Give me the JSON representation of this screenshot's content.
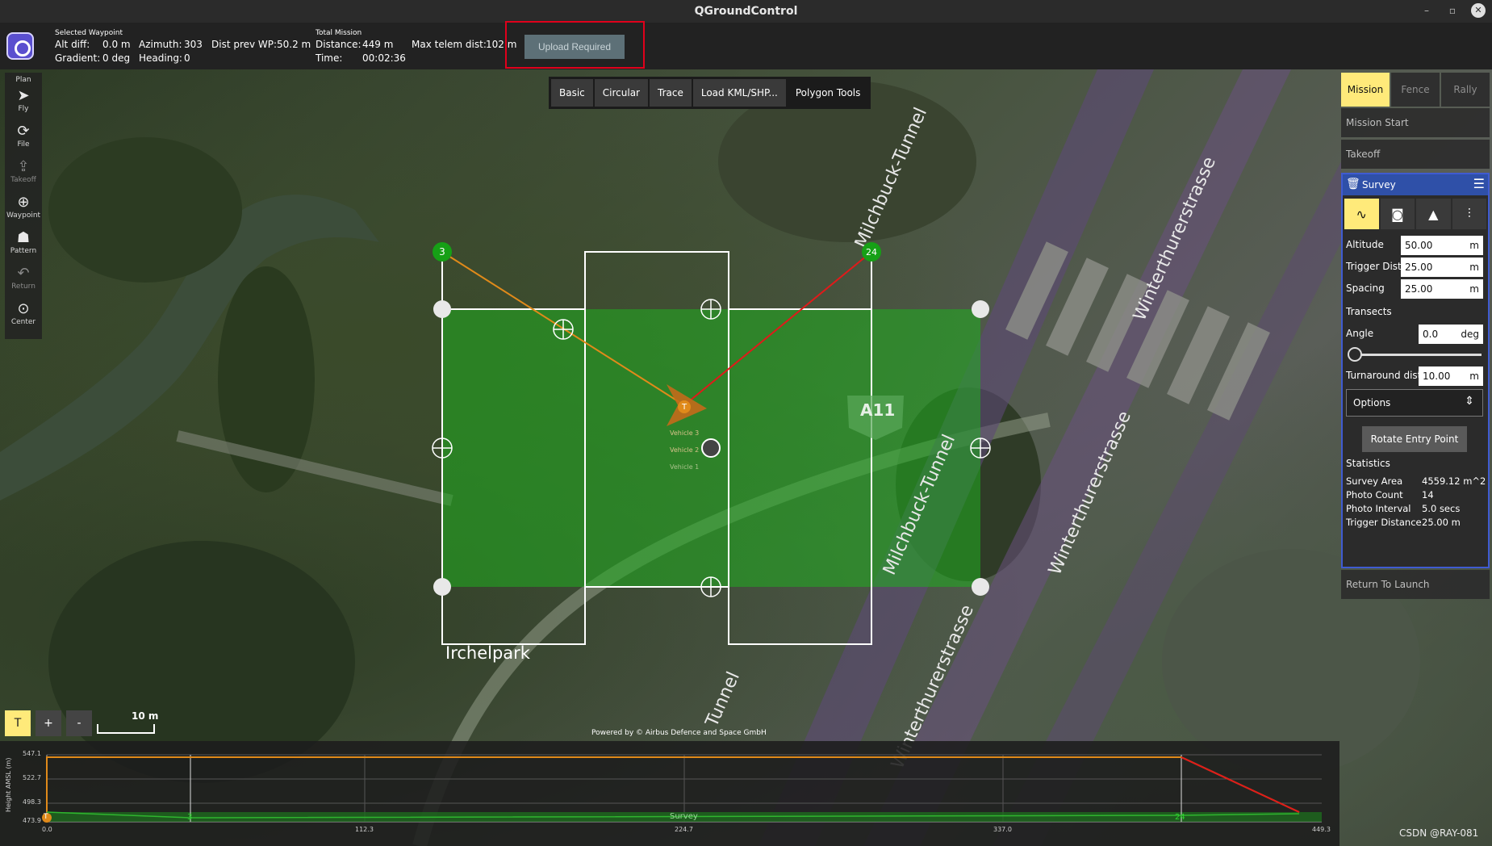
{
  "window": {
    "title": "QGroundControl",
    "controls": [
      "–",
      "▫",
      "✕"
    ]
  },
  "toolbar": {
    "selected_waypoint_title": "Selected Waypoint",
    "alt_diff_label": "Alt diff:",
    "alt_diff_value": "0.0 m",
    "azimuth_label": "Azimuth:",
    "azimuth_value": "303",
    "dist_prev_label": "Dist prev WP:",
    "dist_prev_value": "50.2 m",
    "gradient_label": "Gradient:",
    "gradient_value": "0 deg",
    "heading_label": "Heading:",
    "heading_value": "0",
    "total_mission_title": "Total Mission",
    "distance_label": "Distance:",
    "distance_value": "449 m",
    "max_telem_label": "Max telem dist:",
    "max_telem_value": "102 m",
    "time_label": "Time:",
    "time_value": "00:02:36",
    "upload_label": "Upload Required"
  },
  "left_tools": {
    "header": "Plan",
    "items": [
      {
        "label": "Fly",
        "icon": "paper-plane-icon"
      },
      {
        "label": "File",
        "icon": "file-icon"
      },
      {
        "label": "Takeoff",
        "icon": "takeoff-icon"
      },
      {
        "label": "Waypoint",
        "icon": "waypoint-plus-icon"
      },
      {
        "label": "Pattern",
        "icon": "pattern-icon"
      },
      {
        "label": "Return",
        "icon": "return-icon"
      },
      {
        "label": "Center",
        "icon": "center-icon"
      }
    ]
  },
  "pattern_bar": {
    "basic": "Basic",
    "circular": "Circular",
    "trace": "Trace",
    "load": "Load KML/SHP...",
    "tools": "Polygon Tools"
  },
  "right_panel": {
    "tabs": {
      "mission": "Mission",
      "fence": "Fence",
      "rally": "Rally"
    },
    "mission_start": "Mission Start",
    "takeoff": "Takeoff",
    "survey_title": "Survey",
    "altitude_label": "Altitude",
    "altitude_value": "50.00",
    "altitude_unit": "m",
    "trigger_label": "Trigger Dist",
    "trigger_value": "25.00",
    "trigger_unit": "m",
    "spacing_label": "Spacing",
    "spacing_value": "25.00",
    "spacing_unit": "m",
    "transects_label": "Transects",
    "angle_label": "Angle",
    "angle_value": "0.0",
    "angle_unit": "deg",
    "angle_fraction": 0.0,
    "turnaround_label": "Turnaround dist",
    "turnaround_value": "10.00",
    "turnaround_unit": "m",
    "options_label": "Options",
    "rotate_label": "Rotate Entry Point",
    "statistics_label": "Statistics",
    "stats": [
      {
        "k": "Survey Area",
        "v": "4559.12 m^2"
      },
      {
        "k": "Photo Count",
        "v": "14"
      },
      {
        "k": "Photo Interval",
        "v": "5.0 secs"
      },
      {
        "k": "Trigger Distance",
        "v": "25.00 m"
      }
    ],
    "return_to_launch": "Return To Launch"
  },
  "map": {
    "labels": {
      "irchelpark": "Irchelpark",
      "a11": "A11",
      "milchbuck_1": "Milchbuck-Tunnel",
      "milchbuck_2": "Milchbuck-Tunnel",
      "winterthur_1": "Winterthurerstrasse",
      "winterthur_2": "Winterthurerstrasse",
      "winterthur_3": "Winterthurerstrasse",
      "tunnel": "Tunnel",
      "milchbuck_3": "Milchbuck"
    },
    "waypoint_start": "3",
    "waypoint_end": "24",
    "takeoff_marker": "T",
    "vehicles": [
      "Vehicle 3",
      "Vehicle 2",
      "Vehicle 1"
    ],
    "attribution": "Powered by © Airbus Defence and Space GmbH",
    "scale_label": "10 m",
    "zoom_t": "T",
    "zoom_in": "+",
    "zoom_out": "-",
    "survey_color": "#2fb52f"
  },
  "elevation": {
    "ylabel": "Height AMSL (m)",
    "yticks": [
      "547.1",
      "522.7",
      "498.3",
      "473.9"
    ],
    "xticks": [
      "0.0",
      "112.3",
      "224.7",
      "337.0",
      "449.3"
    ],
    "marker_t": "T",
    "marker_3": "3",
    "marker_24": "24",
    "survey_label": "Survey"
  },
  "watermark": "CSDN @RAY-081"
}
